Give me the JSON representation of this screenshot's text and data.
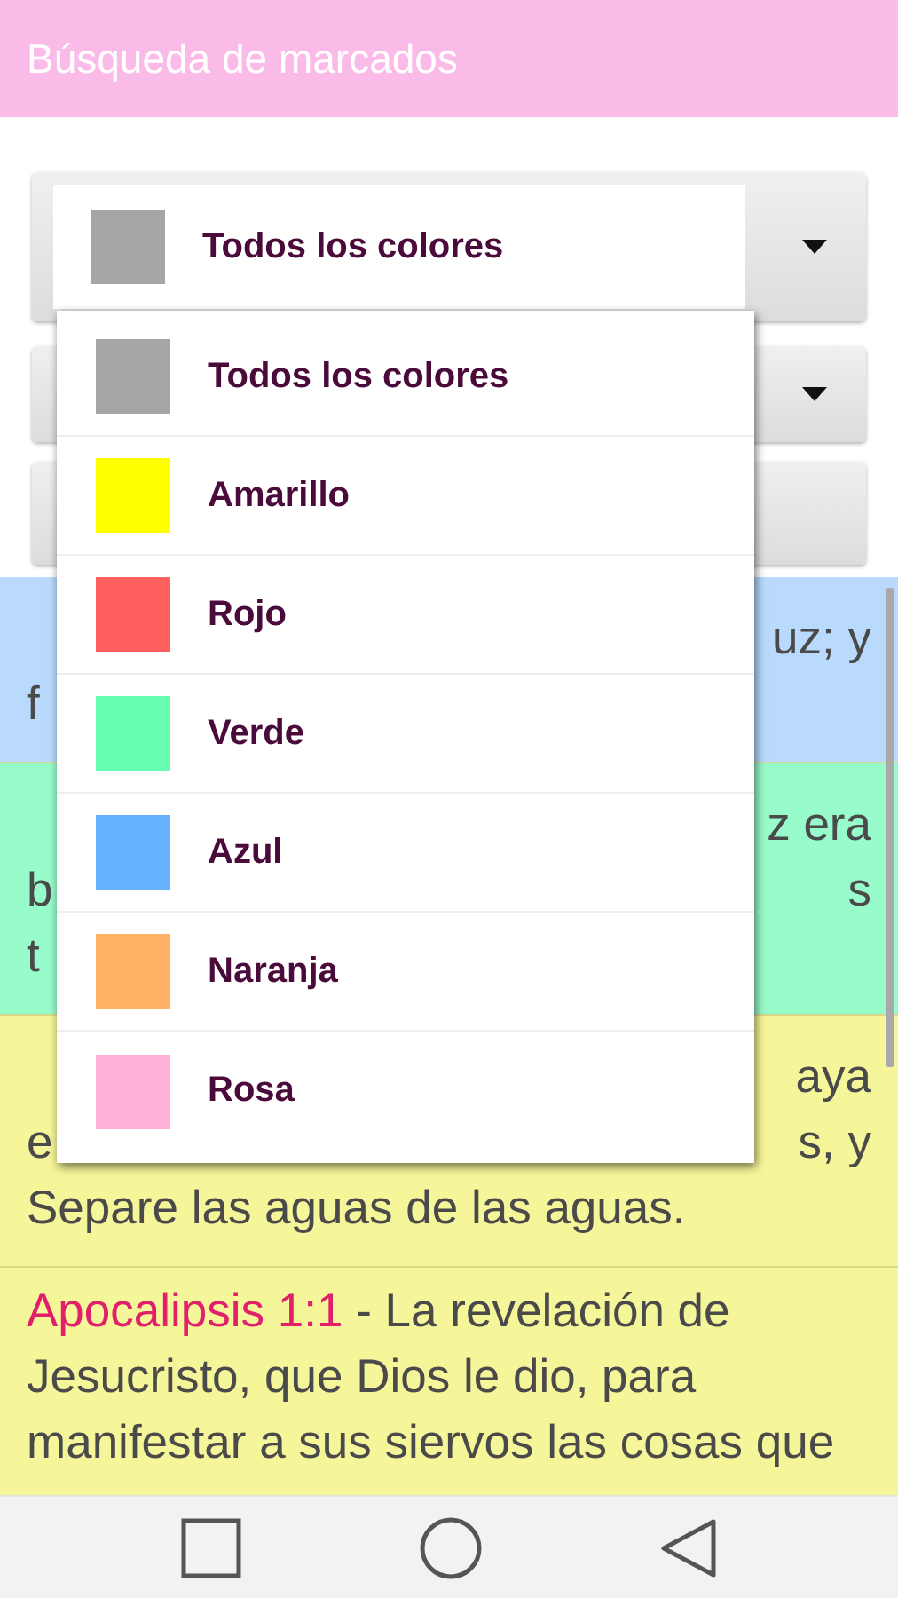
{
  "app_bar": {
    "title": "Búsqueda de marcados"
  },
  "color_spinner": {
    "value": "Todos los colores",
    "color": "#a6a6a6",
    "expanded": true
  },
  "color_options": [
    {
      "label": "Todos los colores",
      "color": "#a6a6a6"
    },
    {
      "label": "Amarillo",
      "color": "#ffff00"
    },
    {
      "label": "Rojo",
      "color": "#ff5f5f"
    },
    {
      "label": "Verde",
      "color": "#66ffb2"
    },
    {
      "label": "Azul",
      "color": "#66b2ff"
    },
    {
      "label": "Naranja",
      "color": "#ffb266"
    },
    {
      "label": "Rosa",
      "color": "#ffb2d9"
    }
  ],
  "results": [
    {
      "kind": "covered",
      "color": "#b9dafc",
      "lines": [
        {
          "right": "uz; y"
        },
        {
          "left": "f"
        }
      ]
    },
    {
      "kind": "covered",
      "color": "#98fbcb",
      "lines": [
        {
          "right": "z era"
        },
        {
          "left": "b",
          "right": "s"
        },
        {
          "left": "t"
        }
      ]
    },
    {
      "kind": "covered",
      "color": "#f5f59a",
      "lines": [
        {
          "right": "aya"
        },
        {
          "left": "e",
          "right": "s, y"
        },
        {
          "left": "Separe las aguas de las aguas."
        }
      ]
    },
    {
      "kind": "full",
      "color": "#f5f59a",
      "reference": "Apocalipsis 1:1",
      "text": "- La revelación de Jesucristo, que Dios le dio, para manifestar a sus siervos las cosas que"
    }
  ]
}
